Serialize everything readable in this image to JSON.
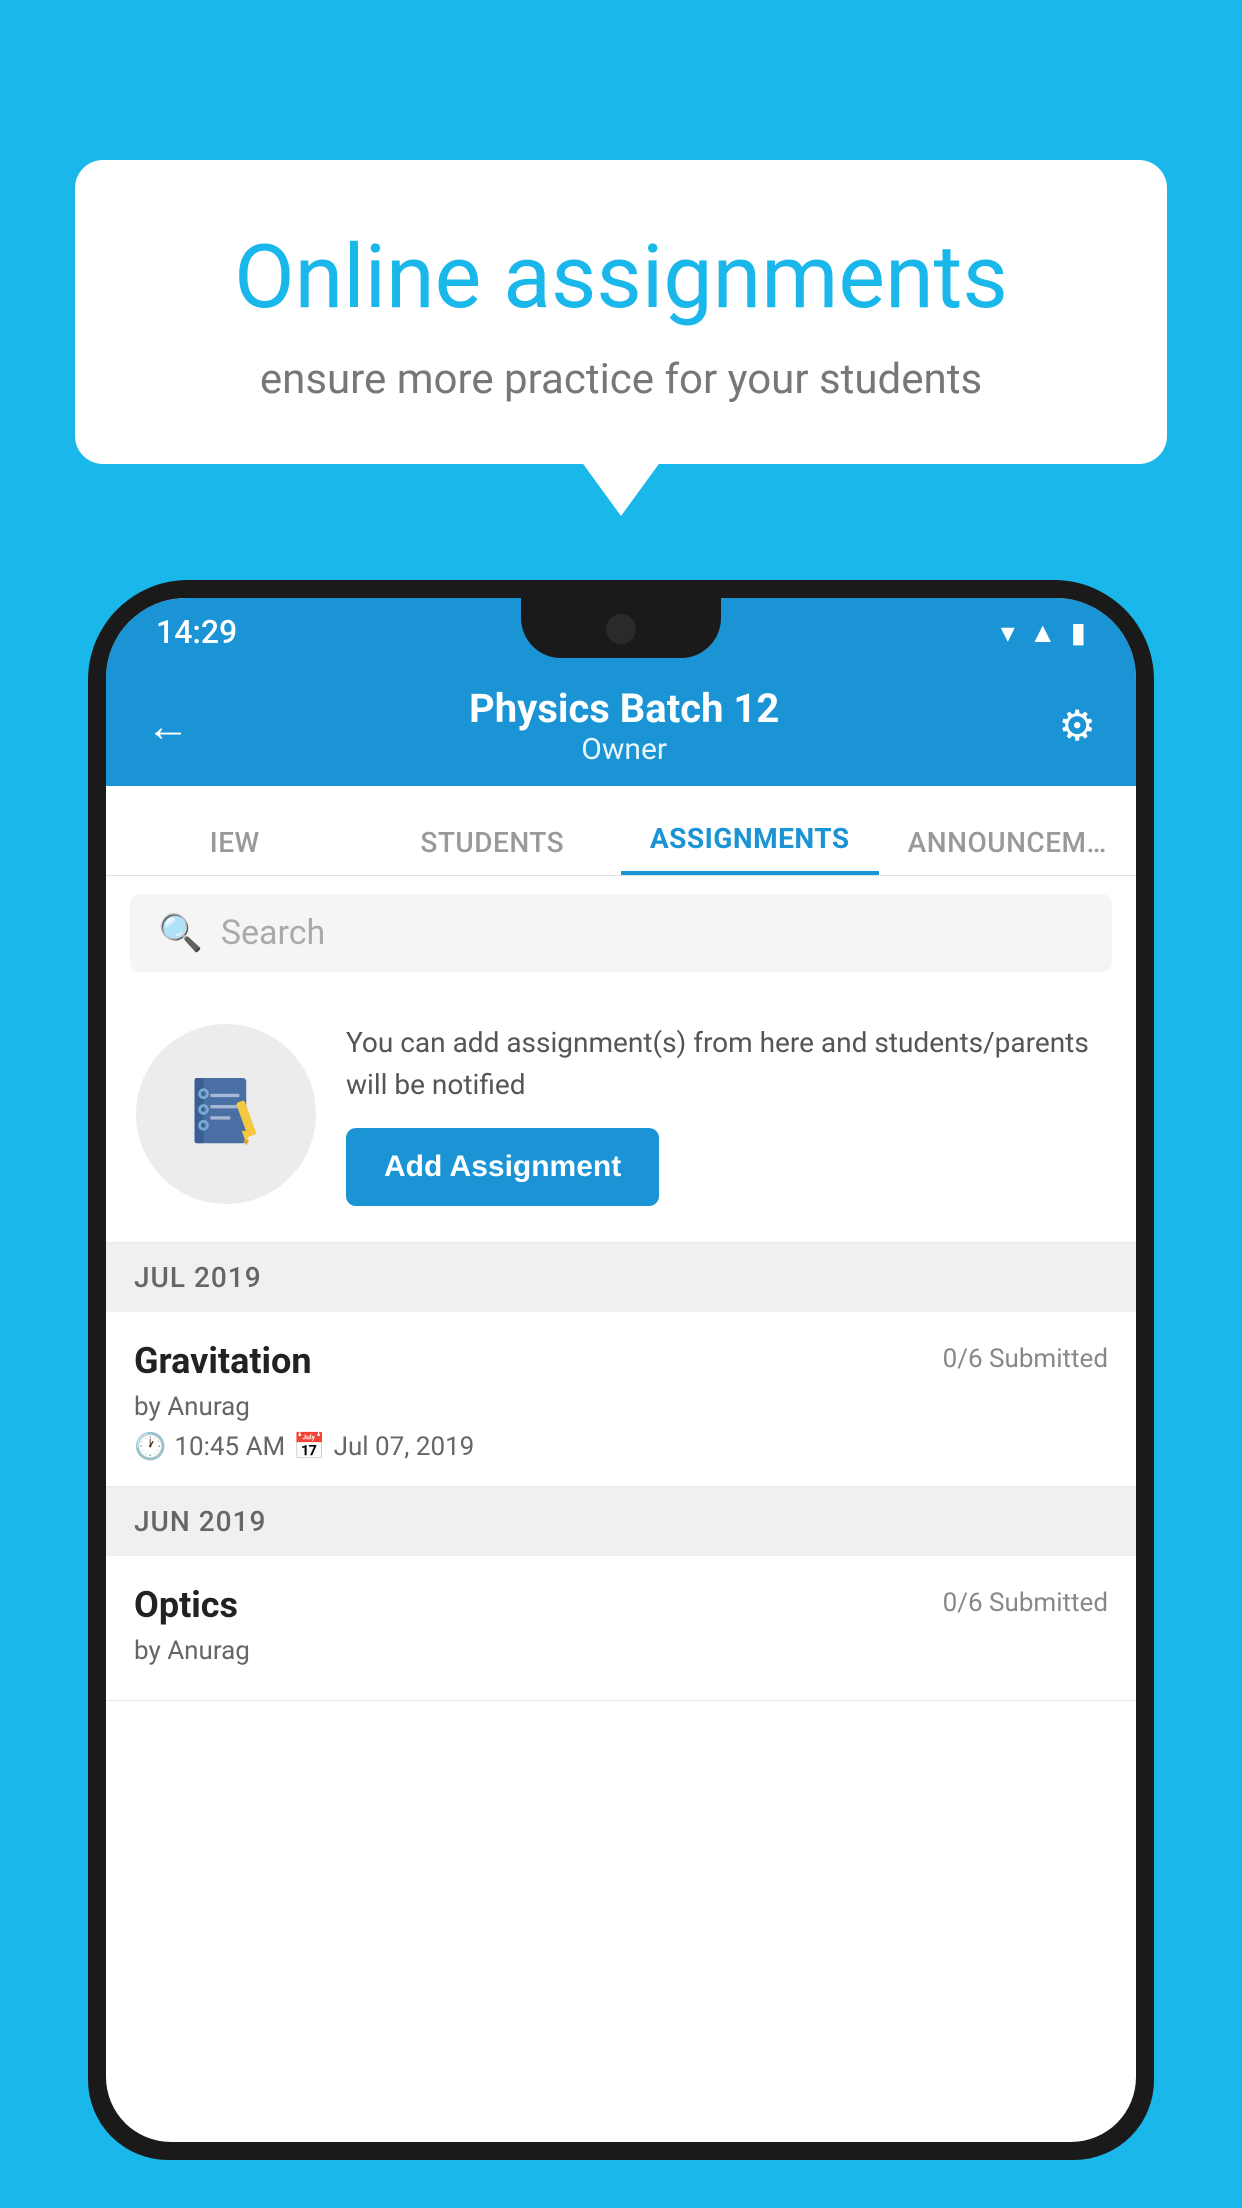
{
  "background_color": "#1ab7ea",
  "speech_bubble": {
    "title": "Online assignments",
    "subtitle": "ensure more practice for your students"
  },
  "phone": {
    "status_bar": {
      "time": "14:29",
      "wifi": "▾",
      "signal": "▲",
      "battery": "▮"
    },
    "header": {
      "title": "Physics Batch 12",
      "subtitle": "Owner",
      "back_label": "←",
      "settings_label": "⚙"
    },
    "tabs": [
      {
        "label": "IEW",
        "active": false
      },
      {
        "label": "STUDENTS",
        "active": false
      },
      {
        "label": "ASSIGNMENTS",
        "active": true
      },
      {
        "label": "ANNOUNCEM…",
        "active": false
      }
    ],
    "search": {
      "placeholder": "Search"
    },
    "promo": {
      "description": "You can add assignment(s) from here and students/parents will be notified",
      "button_label": "Add Assignment"
    },
    "sections": [
      {
        "label": "JUL 2019",
        "assignments": [
          {
            "name": "Gravitation",
            "submitted": "0/6 Submitted",
            "author": "by Anurag",
            "time": "10:45 AM",
            "date": "Jul 07, 2019"
          }
        ]
      },
      {
        "label": "JUN 2019",
        "assignments": [
          {
            "name": "Optics",
            "submitted": "0/6 Submitted",
            "author": "by Anurag",
            "time": "",
            "date": ""
          }
        ]
      }
    ]
  }
}
